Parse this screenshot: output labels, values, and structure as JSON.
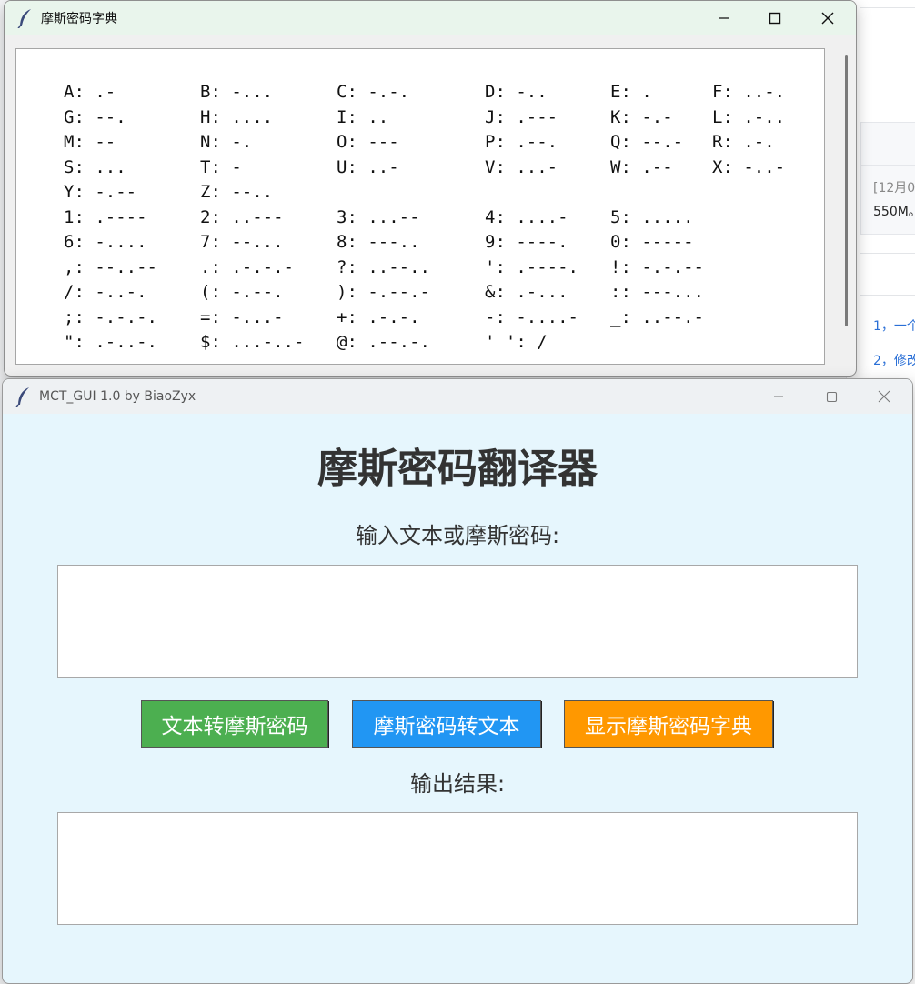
{
  "background": {
    "snippet_1": "[12月0",
    "snippet_2": "550M。",
    "snippet_3": "1，一个",
    "snippet_4": "2，修改"
  },
  "dict_window": {
    "title": "摩斯密码字典",
    "icon": "feather-icon",
    "rows": [
      [
        "A: .-",
        "B: -...",
        "C: -.-.",
        "D: -..",
        "E: .",
        "F: ..-."
      ],
      [
        "G: --.",
        "H: ....",
        "I: ..",
        "J: .---",
        "K: -.-",
        "L: .-.."
      ],
      [
        "M: --",
        "N: -.",
        "O: ---",
        "P: .--.",
        "Q: --.-",
        "R: .-."
      ],
      [
        "S: ...",
        "T: -",
        "U: ..-",
        "V: ...-",
        "W: .--",
        "X: -..-"
      ],
      [
        "Y: -.--",
        "Z: --..",
        "",
        "",
        "",
        ""
      ],
      [
        "1: .----",
        "2: ..---",
        "3: ...--",
        "4: ....-",
        "5: .....",
        ""
      ],
      [
        "6: -....",
        "7: --...",
        "8: ---..",
        "9: ----.",
        "0: -----",
        ""
      ],
      [
        ",: --..--",
        ".: .-.-.-",
        "?: ..--..",
        "': .----.",
        "!: -.-.--",
        ""
      ],
      [
        "/: -..-.",
        "(: -.--.",
        "): -.--.-",
        "&: .-...",
        ":: ---...",
        ""
      ],
      [
        ";: -.-.-.",
        "=: -...-",
        "+: .-.-.",
        "-: -....-",
        "_: ..--.-",
        ""
      ],
      [
        "\": .-..-.",
        "$: ...-..-",
        "@: .--.-.",
        "' ': /",
        "",
        ""
      ]
    ]
  },
  "main_window": {
    "title": "MCT_GUI 1.0 by BiaoZyx",
    "icon": "feather-icon",
    "heading": "摩斯密码翻译器",
    "input_label": "输入文本或摩斯密码:",
    "input_value": "",
    "output_label": "输出结果:",
    "output_value": "",
    "buttons": {
      "text_to_morse": "文本转摩斯密码",
      "morse_to_text": "摩斯密码转文本",
      "show_dict": "显示摩斯密码字典"
    },
    "colors": {
      "text_to_morse": "#4caf50",
      "morse_to_text": "#2196f3",
      "show_dict": "#ff9800",
      "window_bg": "#e6f6fd"
    }
  }
}
